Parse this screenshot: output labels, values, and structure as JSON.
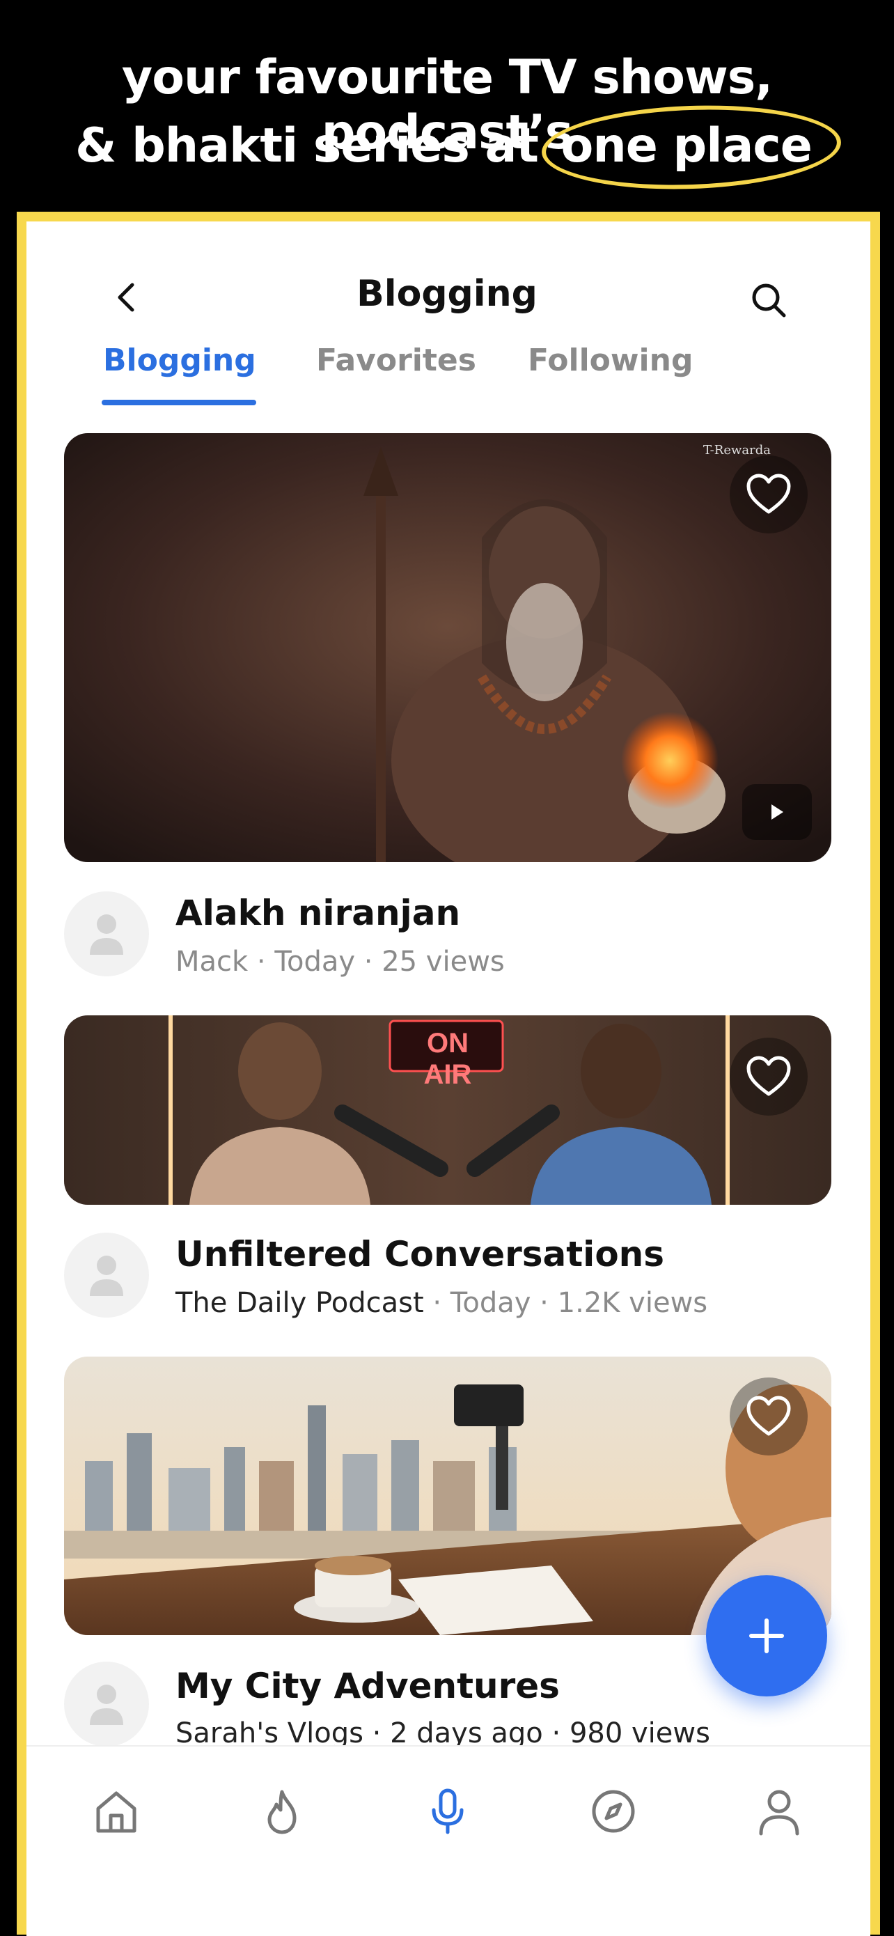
{
  "promo": {
    "line1": "your favourite TV shows, podcast’s",
    "line2_prefix": "& bhakti series at",
    "line2_highlight": "one place"
  },
  "app_bar": {
    "title": "Blogging",
    "back_icon": "chevron-left-icon",
    "search_icon": "search-icon"
  },
  "tabs": [
    {
      "label": "Blogging",
      "active": true
    },
    {
      "label": "Favorites",
      "active": false
    },
    {
      "label": "Following",
      "active": false
    }
  ],
  "posts": [
    {
      "title": "Alakh niranjan",
      "author": "Mack",
      "time": "Today",
      "views": "25 views",
      "image": "ascetic-portrait-image",
      "watermark": "T-Rewarda",
      "has_play": true
    },
    {
      "title": "Unfiltered Conversations",
      "author": "The Daily Podcast",
      "time": "Today",
      "views": "1.2K views",
      "image": "podcast-studio-image",
      "sign_text": "ON AIR",
      "has_play": false
    },
    {
      "title": "My City Adventures",
      "author": "Sarah's Vlogs",
      "time": "2 days ago",
      "views": "980 views",
      "image": "city-vlog-image",
      "has_play": false
    }
  ],
  "separator": " · ",
  "fab_icon": "plus-icon",
  "bottom_nav": [
    {
      "icon": "home-icon",
      "active": false
    },
    {
      "icon": "flame-icon",
      "active": false
    },
    {
      "icon": "microphone-icon",
      "active": true
    },
    {
      "icon": "compass-icon",
      "active": false
    },
    {
      "icon": "profile-icon",
      "active": false
    }
  ],
  "colors": {
    "accent": "#2b6fe0",
    "frame": "#f7d84d",
    "highlight_ring": "#f5d54a"
  }
}
